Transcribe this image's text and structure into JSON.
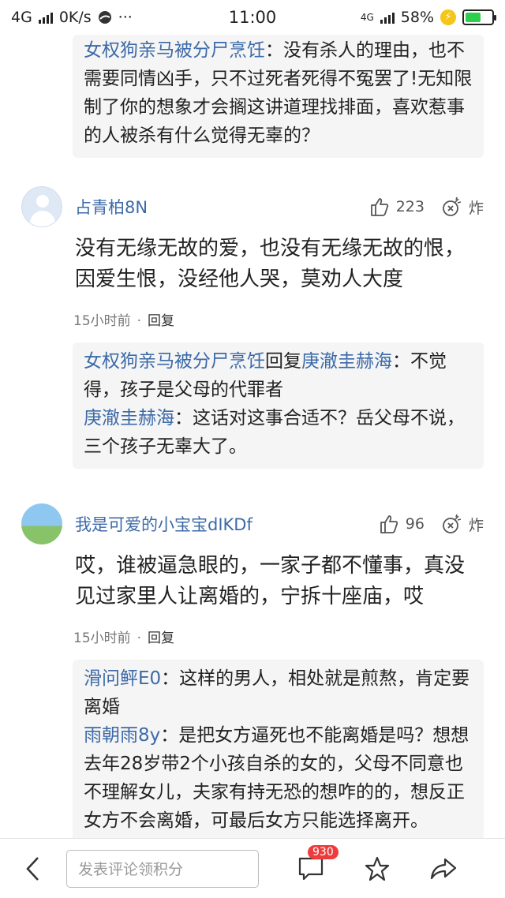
{
  "status_bar": {
    "network": "4G",
    "speed": "0K/s",
    "dots": "···",
    "time": "11:00",
    "network_right": "4G",
    "battery": "58%",
    "battery_level": 0.58
  },
  "top_replies": [
    {
      "name": "女权狗亲马被分尸烹饪",
      "sep": "：",
      "text": "没有杀人的理由，也不需要同情凶手，只不过死者死得不冤罢了!无知限制了你的想象才会搁这讲道理找排面，喜欢惹事的人被杀有什么觉得无辜的？"
    }
  ],
  "comments": [
    {
      "user": "占青柏8N",
      "likes": "223",
      "boom_label": "炸",
      "text": "没有无缘无故的爱，也没有无缘无故的恨，因爱生恨，没经他人哭，莫劝人大度",
      "time": "15小时前",
      "dot": "·",
      "reply_label": "回复",
      "replies": [
        {
          "name": "女权狗亲马被分尸烹饪",
          "mid": "回复",
          "target": "庚澈圭赫海",
          "sep": "：",
          "text": "不觉得，孩子是父母的代罪者"
        },
        {
          "name": "庚澈圭赫海",
          "mid": "",
          "target": "",
          "sep": "：",
          "text": "这话对这事合适不？岳父母不说，三个孩子无辜大了。"
        }
      ]
    },
    {
      "user": "我是可爱的小宝宝dIKDf",
      "likes": "96",
      "boom_label": "炸",
      "text": "哎，谁被逼急眼的，一家子都不懂事，真没见过家里人让离婚的，宁拆十座庙，哎",
      "time": "15小时前",
      "dot": "·",
      "reply_label": "回复",
      "replies": [
        {
          "name": "滑问鲆E0",
          "mid": "",
          "target": "",
          "sep": "：",
          "text": "这样的男人，相处就是煎熬，肯定要离婚"
        },
        {
          "name": "雨朝雨8y",
          "mid": "",
          "target": "",
          "sep": "：",
          "text": "是把女方逼死也不能离婚是吗？想想去年28岁带2个小孩自杀的女的，父母不同意也不理解女儿，夫家有持无恐的想咋的的，想反正女方不会离婚，可最后女方只能选择离开。"
        }
      ]
    }
  ],
  "bottom_bar": {
    "input_placeholder": "发表评论领积分",
    "comment_count": "930"
  }
}
